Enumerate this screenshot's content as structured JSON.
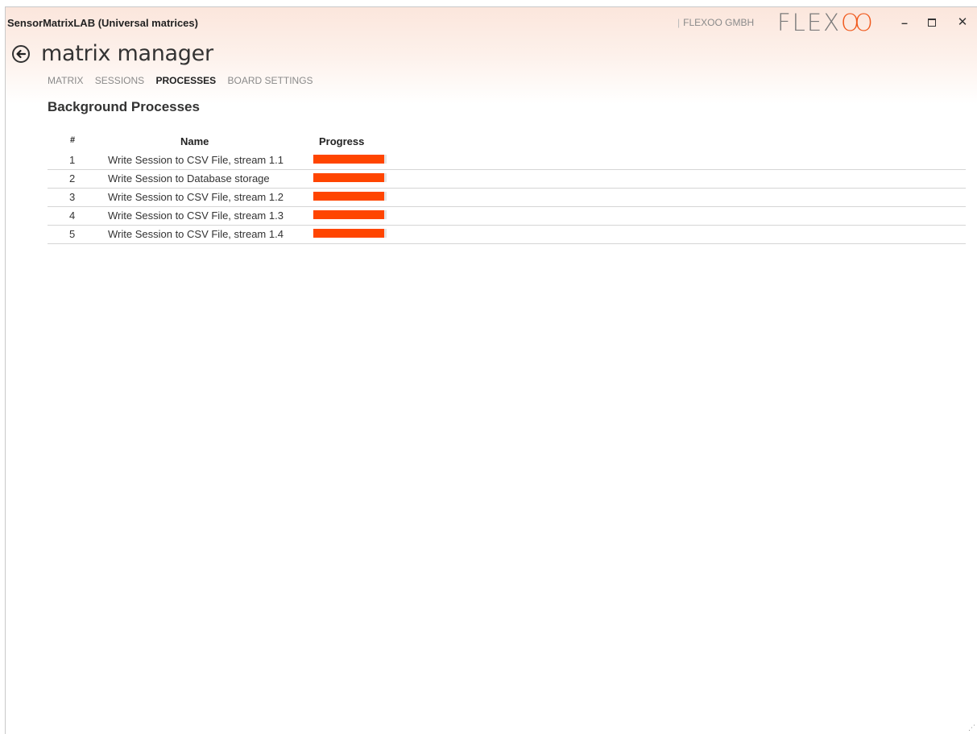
{
  "window": {
    "title": "SensorMatrixLAB (Universal matrices)",
    "company": "FLEXOO GMBH",
    "logo_text": "FLEX",
    "logo_suffix": "OO",
    "controls": {
      "minimize": "–",
      "close": "✕"
    }
  },
  "page": {
    "title": "matrix manager",
    "tabs": [
      {
        "label": "MATRIX",
        "active": false
      },
      {
        "label": "SESSIONS",
        "active": false
      },
      {
        "label": "PROCESSES",
        "active": true
      },
      {
        "label": "BOARD SETTINGS",
        "active": false
      }
    ]
  },
  "processes": {
    "section_title": "Background Processes",
    "columns": {
      "num": "#",
      "name": "Name",
      "progress": "Progress"
    },
    "rows": [
      {
        "num": "1",
        "name": "Write Session to CSV File, stream 1.1",
        "progress": 0.97
      },
      {
        "num": "2",
        "name": "Write Session to Database storage",
        "progress": 0.97
      },
      {
        "num": "3",
        "name": "Write Session to CSV File, stream 1.2",
        "progress": 0.97
      },
      {
        "num": "4",
        "name": "Write Session to CSV File, stream 1.3",
        "progress": 0.97
      },
      {
        "num": "5",
        "name": "Write Session to CSV File, stream 1.4",
        "progress": 0.97
      }
    ]
  },
  "colors": {
    "accent": "#ff4500",
    "brand_orange": "#f05a1e"
  }
}
